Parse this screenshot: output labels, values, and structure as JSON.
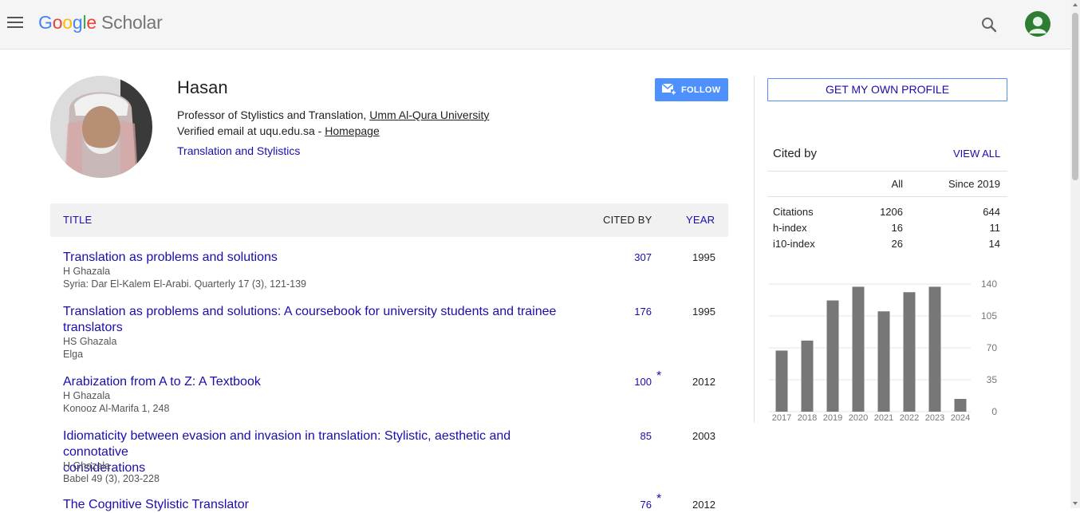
{
  "topbar": {
    "logo_letters": [
      "G",
      "o",
      "o",
      "g",
      "l",
      "e"
    ],
    "logo_product": "Scholar",
    "menu_icon": "hamburger-menu-icon",
    "search_icon": "search-icon",
    "account_icon": "account-avatar-icon"
  },
  "profile": {
    "name": "Hasan",
    "affiliation_prefix": "Professor of Stylistics and Translation, ",
    "affiliation_link": "Umm Al-Qura University",
    "email_prefix": "Verified email at uqu.edu.sa - ",
    "homepage_link": "Homepage",
    "interests": "Translation and Stylistics",
    "follow_label": "FOLLOW"
  },
  "table": {
    "headers": {
      "title": "TITLE",
      "cited_by": "CITED BY",
      "year": "YEAR"
    },
    "rows": [
      {
        "title_lines": [
          "Translation as problems and solutions"
        ],
        "authors": "H Ghazala",
        "venue": "Syria: Dar El-Kalem El-Arabi. Quarterly 17 (3), 121-139",
        "cited": "307",
        "star": "",
        "year": "1995"
      },
      {
        "title_lines": [
          "Translation as problems and solutions: A coursebook for university students and trainee",
          "translators"
        ],
        "authors": "HS Ghazala",
        "venue": "Elga",
        "cited": "176",
        "star": "",
        "year": "1995"
      },
      {
        "title_lines": [
          "Arabization from A to Z: A Textbook"
        ],
        "authors": "H Ghazala",
        "venue": "Konooz Al-Marifa 1, 248",
        "cited": "100",
        "star": "*",
        "year": "2012"
      },
      {
        "title_lines": [
          "Idiomaticity between evasion and invasion in translation: Stylistic, aesthetic and connotative",
          "considerations"
        ],
        "authors": "H Ghazala",
        "venue": "Babel 49 (3), 203-228",
        "cited": "85",
        "star": "",
        "year": "2003"
      },
      {
        "title_lines": [
          "The Cognitive Stylistic Translator"
        ],
        "authors": "",
        "venue": "",
        "cited": "76",
        "star": "*",
        "year": "2012"
      }
    ]
  },
  "sidebar": {
    "own_profile_label": "GET MY OWN PROFILE",
    "cited_by_title": "Cited by",
    "view_all_label": "VIEW ALL",
    "col_all": "All",
    "col_since": "Since 2019",
    "stats": [
      {
        "label": "Citations",
        "all": "1206",
        "since": "644"
      },
      {
        "label": "h-index",
        "all": "16",
        "since": "11"
      },
      {
        "label": "i10-index",
        "all": "26",
        "since": "14"
      }
    ]
  },
  "chart_data": {
    "type": "bar",
    "categories": [
      "2017",
      "2018",
      "2019",
      "2020",
      "2021",
      "2022",
      "2023",
      "2024"
    ],
    "values": [
      67,
      78,
      122,
      137,
      110,
      131,
      137,
      14
    ],
    "ylim": [
      0,
      140
    ],
    "yticks": [
      "0",
      "35",
      "70",
      "105",
      "140"
    ],
    "bar_color": "#777777",
    "grid": true,
    "title": "",
    "xlabel": "",
    "ylabel": ""
  },
  "colors": {
    "link": "#1a0dab",
    "follow_button": "#4d90fe",
    "avatar_bg": "#2e7d32"
  }
}
